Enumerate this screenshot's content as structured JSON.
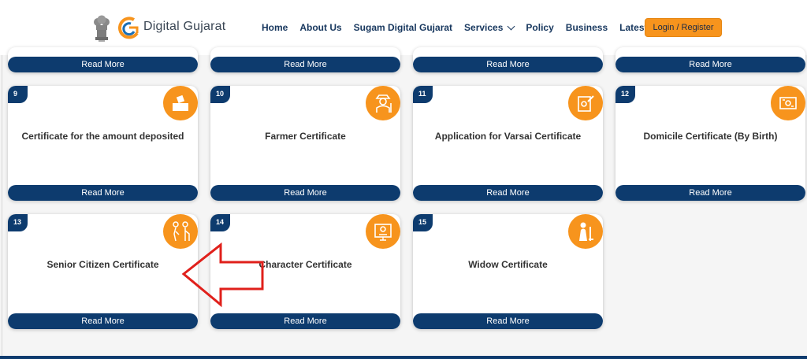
{
  "header": {
    "logo_text": "Digital Gujarat",
    "emblem_icon": "state-emblem-icon",
    "nav": [
      {
        "label": "Home"
      },
      {
        "label": "About Us"
      },
      {
        "label": "Sugam Digital Gujarat"
      },
      {
        "label": "Services",
        "has_dropdown": true
      },
      {
        "label": "Policy"
      },
      {
        "label": "Business"
      },
      {
        "label": "Latest Update"
      }
    ],
    "login_label": "Login / Register"
  },
  "read_more_label": "Read More",
  "cards": [
    {
      "number": "9",
      "title": "Certificate for the amount deposited",
      "icon": "deposit-icon"
    },
    {
      "number": "10",
      "title": "Farmer Certificate",
      "icon": "farmer-icon"
    },
    {
      "number": "11",
      "title": "Application for Varsai Certificate",
      "icon": "certificate-application-icon"
    },
    {
      "number": "12",
      "title": "Domicile Certificate (By Birth)",
      "icon": "domicile-certificate-icon"
    },
    {
      "number": "13",
      "title": "Senior Citizen Certificate",
      "icon": "senior-citizen-icon"
    },
    {
      "number": "14",
      "title": "Character Certificate",
      "icon": "character-certificate-icon"
    },
    {
      "number": "15",
      "title": "Widow Certificate",
      "icon": "widow-icon"
    }
  ],
  "colors": {
    "navy": "#0d3b6e",
    "orange": "#f7941d",
    "annotation_red": "#e0201b"
  }
}
